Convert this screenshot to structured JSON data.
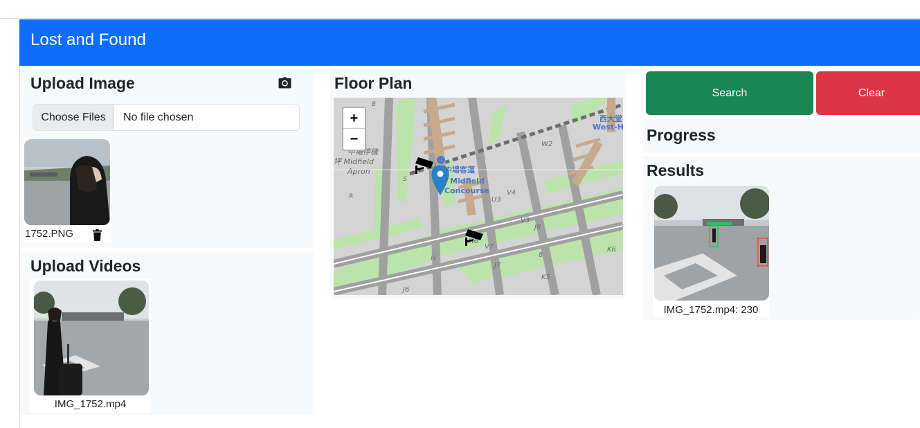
{
  "app": {
    "title": "Lost and Found"
  },
  "upload_image": {
    "heading": "Upload Image",
    "choose_label": "Choose Files",
    "status": "No file chosen",
    "files": [
      {
        "name": "1752.PNG"
      }
    ]
  },
  "upload_videos": {
    "heading": "Upload Videos",
    "files": [
      {
        "name": "IMG_1752.mp4"
      }
    ]
  },
  "floor_plan": {
    "heading": "Floor Plan",
    "zoom_in": "+",
    "zoom_out": "−",
    "labels": {
      "midfield_cn": "中場停機",
      "midfield_apron1": "坪 Midfield",
      "midfield_apron2": "Apron",
      "concourse_cn": "中場客運",
      "concourse1": "Midfield",
      "concourse2": "Concourse",
      "west_cn": "西大堂",
      "west": "West-Ha",
      "road_b": "B",
      "road_s": "S",
      "road_r": "R",
      "road_w2": "W2",
      "road_v4": "V4",
      "road_u3": "U3",
      "road_j8": "J8",
      "road_h6": "H6",
      "road_v7": "V7",
      "road_j7": "J7",
      "road_j6": "J6",
      "road_h": "H",
      "road_k5": "K5",
      "road_k6": "K6",
      "road_v3": "V3",
      "road_8": "8"
    }
  },
  "actions": {
    "search": "Search",
    "clear": "Clear"
  },
  "progress": {
    "heading": "Progress"
  },
  "results": {
    "heading": "Results",
    "items": [
      {
        "label": "IMG_1752.mp4: 230"
      }
    ]
  },
  "colors": {
    "navbar": "#0d6efd",
    "search": "#198754",
    "clear": "#dc3545",
    "panel": "#f8f9fa",
    "map_grass": "#b5e3a6",
    "map_road": "#9f9f9f",
    "marker": "#2a81cb"
  },
  "icons": [
    "camera-icon",
    "trash-icon",
    "cctv-camera-icon",
    "map-marker-icon"
  ]
}
